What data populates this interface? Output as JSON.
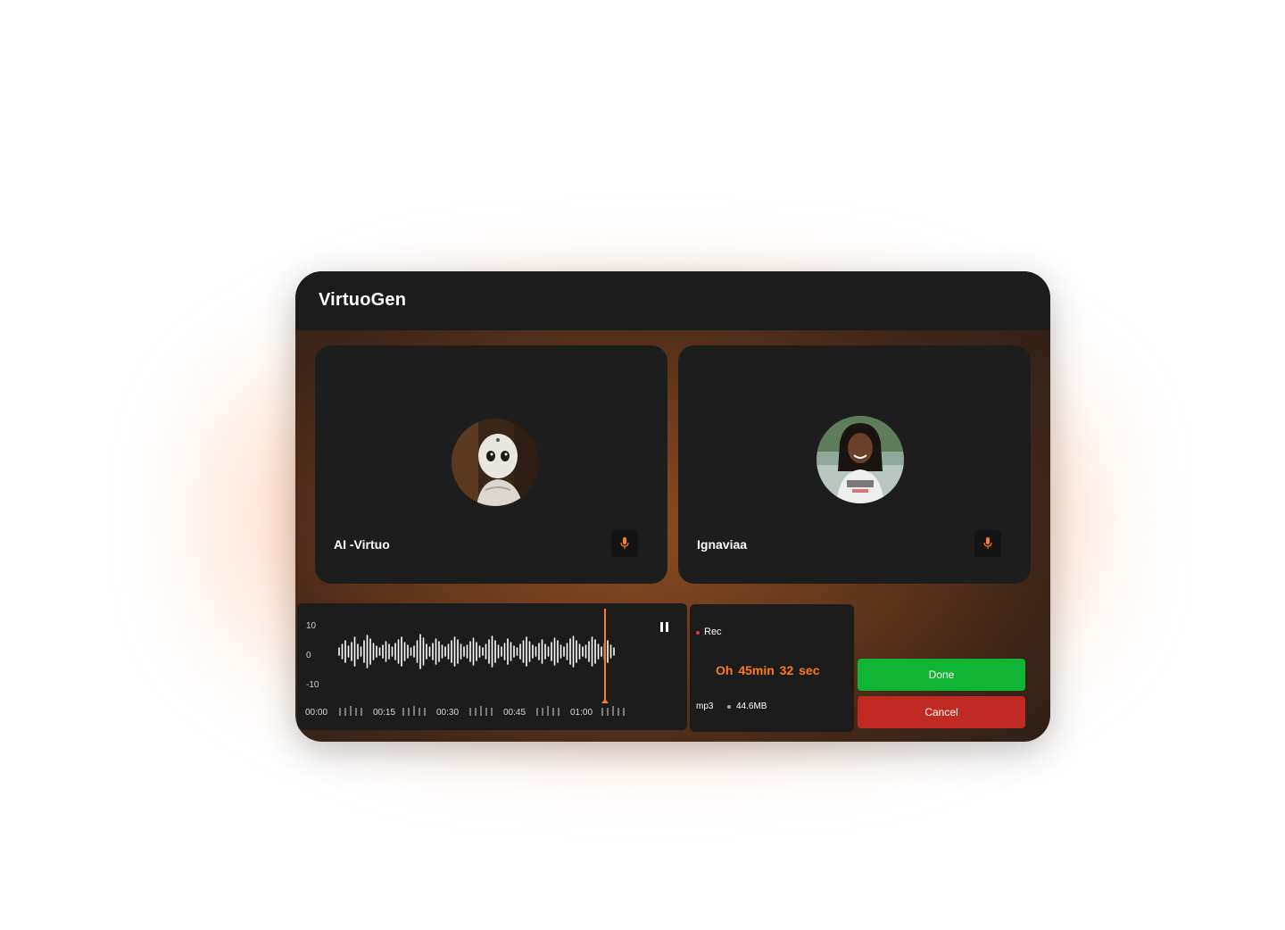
{
  "app": {
    "title": "VirtuoGen"
  },
  "participants": [
    {
      "name": "AI -Virtuo",
      "icon": "mic-icon",
      "accent": "#ff7a1a"
    },
    {
      "name": "Ignaviaa",
      "icon": "mic-icon",
      "accent": "#ff7a1a"
    }
  ],
  "waveform": {
    "y_ticks": [
      "10",
      "0",
      "-10"
    ],
    "time_labels": [
      "00:00",
      "00:15",
      "00:30",
      "00:45",
      "01:00"
    ],
    "playhead_color": "#ff7a1a",
    "control_icon": "pause-icon"
  },
  "recording": {
    "status": "Rec",
    "duration": "Oh  45min  32 sec",
    "format": "mp3",
    "size": "44.6MB",
    "status_color": "#e53b2b",
    "duration_color": "#ff7a1a"
  },
  "actions": {
    "done_label": "Done",
    "cancel_label": "Cancel",
    "done_color": "#10b534",
    "cancel_color": "#c12a22"
  }
}
